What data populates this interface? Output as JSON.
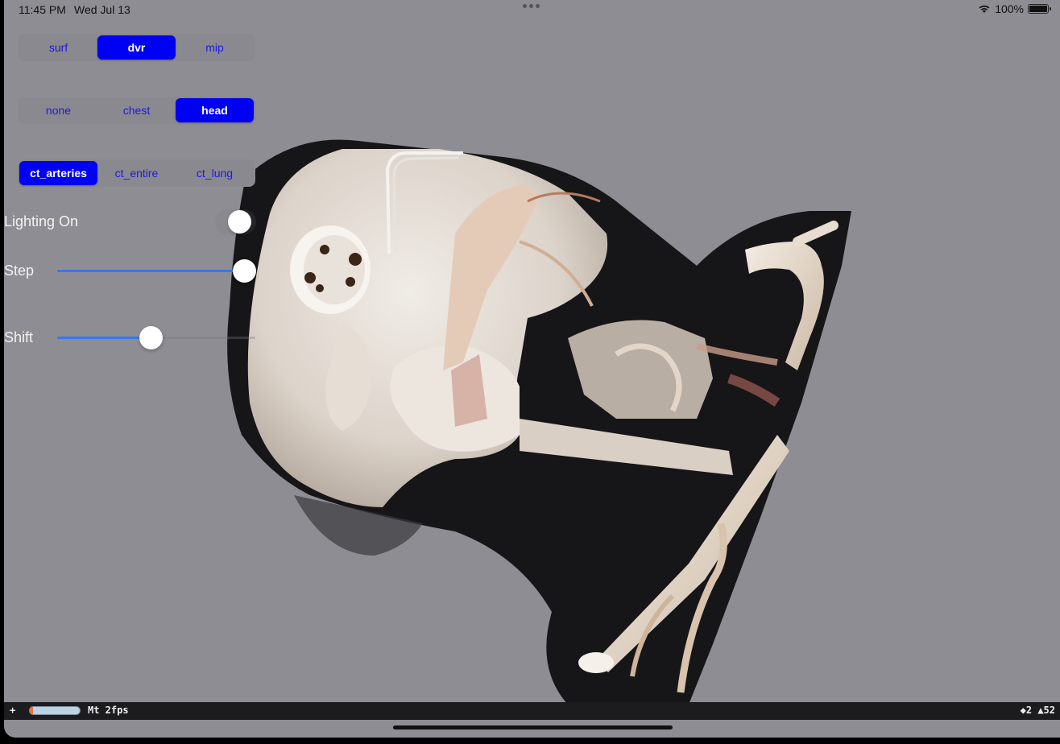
{
  "status_bar": {
    "time": "11:45 PM",
    "date": "Wed Jul 13",
    "battery": "100%",
    "wifi_icon": "wifi-icon",
    "battery_icon": "battery-icon"
  },
  "render_mode": {
    "options": [
      "surf",
      "dvr",
      "mip"
    ],
    "selected": "dvr"
  },
  "body_preset": {
    "options": [
      "none",
      "chest",
      "head"
    ],
    "selected": "head"
  },
  "transfer_function": {
    "options": [
      "ct_arteries",
      "ct_entire",
      "ct_lung"
    ],
    "selected": "ct_arteries"
  },
  "lighting": {
    "label": "Lighting On",
    "on": false
  },
  "step": {
    "label": "Step",
    "value_fraction": 1.0
  },
  "shift": {
    "label": "Shift",
    "value_fraction": 0.5
  },
  "debug_bar": {
    "plus": "+",
    "fps_label": "Mt 2fps",
    "right_stats": "◆2 ▲52"
  },
  "colors": {
    "background": "#8e8d93",
    "accent": "#0000f5",
    "slider_fill": "#3478f6"
  }
}
